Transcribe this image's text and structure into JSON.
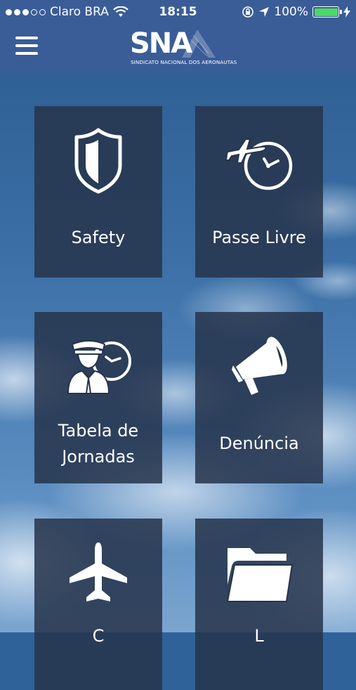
{
  "status_bar": {
    "carrier": "Claro BRA",
    "time": "18:15",
    "battery_percent": "100%",
    "signal_bars": 3,
    "signal_total": 5,
    "battery_level": 1.0,
    "battery_color": "#4cd964"
  },
  "header": {
    "logo_text": "SNA",
    "logo_subtitle": "SINDICATO NACIONAL DOS AERONAUTAS",
    "menu_icon": "hamburger-menu-icon",
    "background": "#3a5d98"
  },
  "tiles": [
    {
      "label": "Safety",
      "icon": "shield-icon"
    },
    {
      "label": "Passe Livre",
      "icon": "plane-clock-icon"
    },
    {
      "label": "Tabela de Jornadas",
      "label_line1": "Tabela de",
      "label_line2": "Jornadas",
      "icon": "pilot-clock-icon"
    },
    {
      "label": "Denúncia",
      "icon": "megaphone-icon"
    },
    {
      "label": "C",
      "icon": "airplane-icon"
    },
    {
      "label": "L",
      "icon": "folder-icon"
    }
  ]
}
